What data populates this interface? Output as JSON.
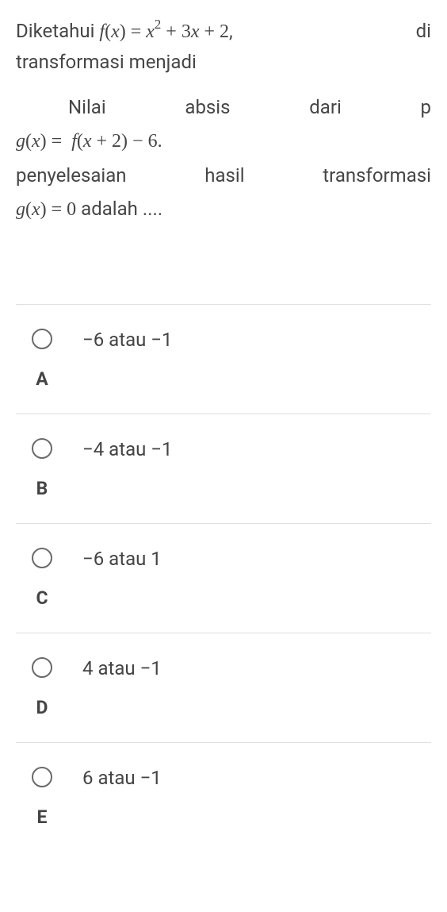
{
  "question": {
    "line1_left": "Diketahui ",
    "line1_math": "f(x) = x² + 3x + 2",
    "line1_comma": ",",
    "line1_right": "di",
    "line2": "transformasi menjadi",
    "line3_w1": "Nilai",
    "line3_w2": "absis",
    "line3_w3": "dari",
    "line3_w4": "p",
    "line4_math": "g(x) = f(x + 2) − 6.",
    "line5_w1": "penyelesaian",
    "line5_w2": "hasil",
    "line5_w3": "transformasi",
    "line6_math": "g(x) = 0",
    "line6_text": " adalah ...."
  },
  "options": [
    {
      "letter": "A",
      "text": "−6 atau −1"
    },
    {
      "letter": "B",
      "text": "−4 atau −1"
    },
    {
      "letter": "C",
      "text": "−6 atau 1"
    },
    {
      "letter": "D",
      "text": "4 atau −1"
    },
    {
      "letter": "E",
      "text": "6 atau −1"
    }
  ],
  "chart_data": {
    "type": "table",
    "title": "Multiple choice question with math expressions",
    "f_of_x": "x^2 + 3x + 2",
    "g_of_x": "f(x + 2) - 6",
    "equation_to_solve": "g(x) = 0",
    "choices": {
      "A": "-6 or -1",
      "B": "-4 or -1",
      "C": "-6 or 1",
      "D": "4 or -1",
      "E": "6 or -1"
    }
  }
}
